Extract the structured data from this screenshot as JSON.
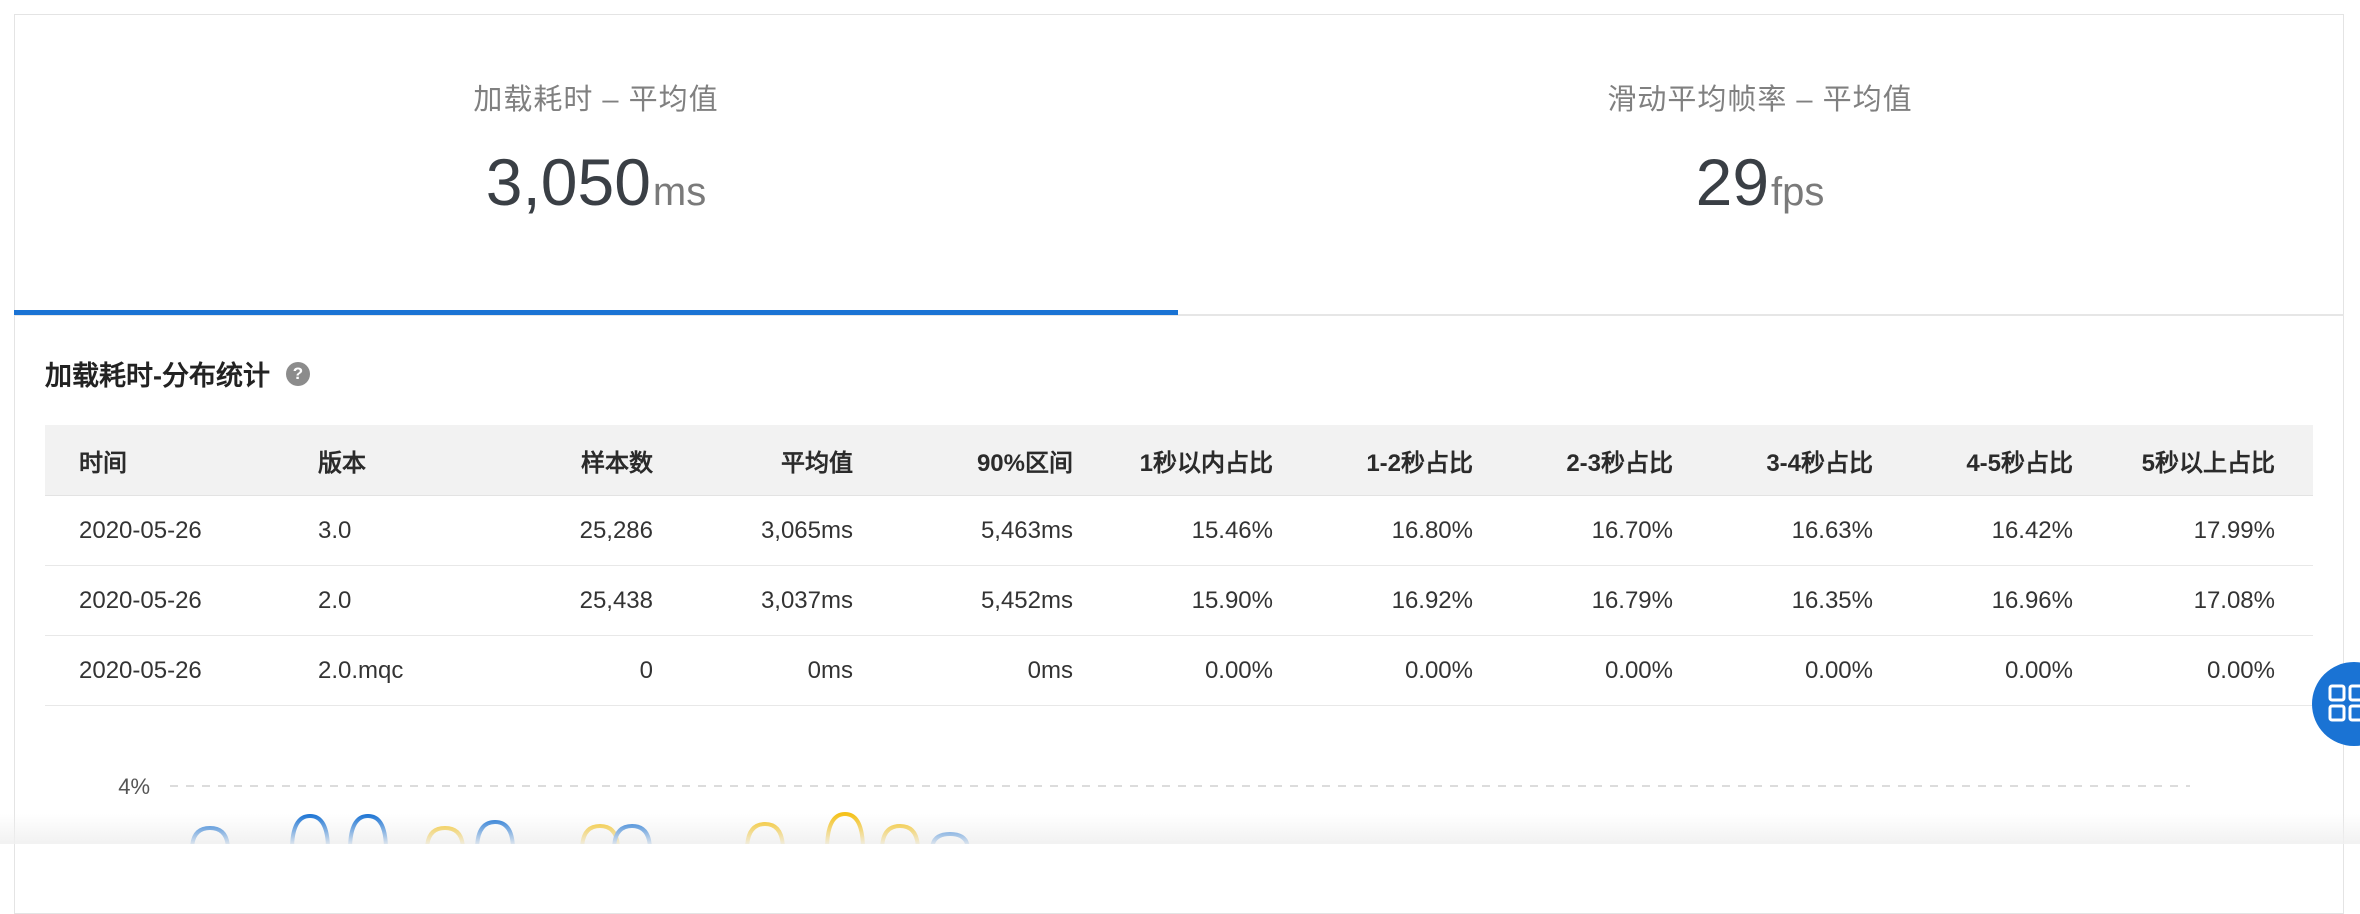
{
  "metrics": [
    {
      "title": "加载耗时 – 平均值",
      "value": "3,050",
      "unit": "ms",
      "active": true
    },
    {
      "title": "滑动平均帧率 – 平均值",
      "value": "29",
      "unit": "fps",
      "active": false
    }
  ],
  "section": {
    "title": "加载耗时-分布统计",
    "help": "?"
  },
  "table": {
    "columns": [
      "时间",
      "版本",
      "样本数",
      "平均值",
      "90%区间",
      "1秒以内占比",
      "1-2秒占比",
      "2-3秒占比",
      "3-4秒占比",
      "4-5秒占比",
      "5秒以上占比"
    ],
    "rows": [
      [
        "2020-05-26",
        "3.0",
        "25,286",
        "3,065ms",
        "5,463ms",
        "15.46%",
        "16.80%",
        "16.70%",
        "16.63%",
        "16.42%",
        "17.99%"
      ],
      [
        "2020-05-26",
        "2.0",
        "25,438",
        "3,037ms",
        "5,452ms",
        "15.90%",
        "16.92%",
        "16.79%",
        "16.35%",
        "16.96%",
        "17.08%"
      ],
      [
        "2020-05-26",
        "2.0.mqc",
        "0",
        "0ms",
        "0ms",
        "0.00%",
        "0.00%",
        "0.00%",
        "0.00%",
        "0.00%",
        "0.00%"
      ]
    ]
  },
  "chart_data": {
    "type": "line",
    "y_ticks": [
      "4%"
    ],
    "grid": true,
    "series_colors": [
      "#1a73d4",
      "#f5c21b"
    ]
  },
  "colors": {
    "accent": "#1a73d4",
    "series_yellow": "#f5c21b"
  },
  "fab_icon": "grid-apps-icon"
}
